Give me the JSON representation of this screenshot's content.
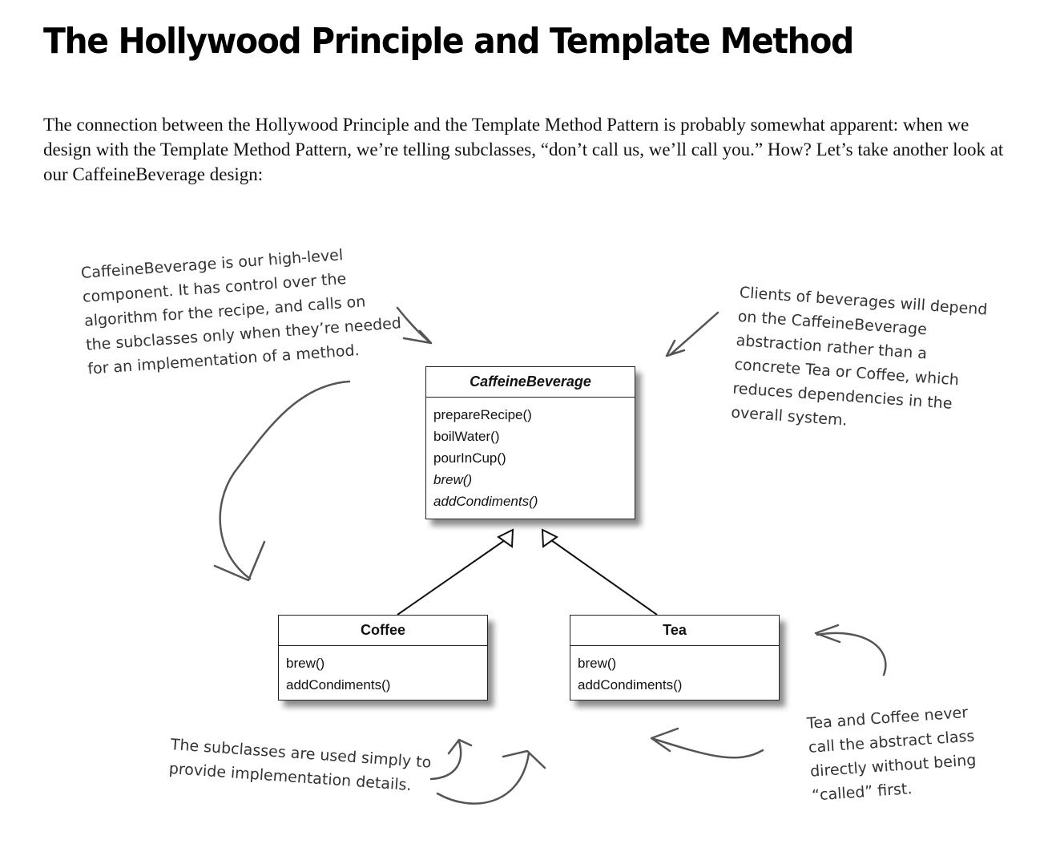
{
  "title": "The Hollywood Principle and Template Method",
  "intro": "The connection between the Hollywood Principle and the Template Method Pattern is probably somewhat apparent: when we design with the Template Method Pattern, we’re telling subclasses, “don’t call us, we’ll call you.”  How?  Let’s take another look at our CaffeineBeverage design:",
  "classes": {
    "caffeine": {
      "name": "CaffeineBeverage",
      "methods": [
        "prepareRecipe()",
        "boilWater()",
        "pourInCup()",
        "brew()",
        "addCondiments()"
      ]
    },
    "coffee": {
      "name": "Coffee",
      "methods": [
        "brew()",
        "addCondiments()"
      ]
    },
    "tea": {
      "name": "Tea",
      "methods": [
        "brew()",
        "addCondiments()"
      ]
    }
  },
  "notes": {
    "high_level": [
      "CaffeineBeverage is our high-level",
      "component.  It has control over the",
      "algorithm for the recipe, and calls on",
      "the subclasses only when they’re needed",
      "for an implementation of a method."
    ],
    "clients": [
      "Clients of beverages will depend",
      "on the CaffeineBeverage",
      "abstraction rather than a",
      "concrete Tea or Coffee, which",
      "reduces dependencies in the",
      "overall system."
    ],
    "subclasses": [
      "The subclasses are used simply to",
      "provide implementation details."
    ],
    "never_call": [
      "Tea and Coffee never",
      "call the abstract class",
      "directly without being",
      "“called” first."
    ]
  }
}
